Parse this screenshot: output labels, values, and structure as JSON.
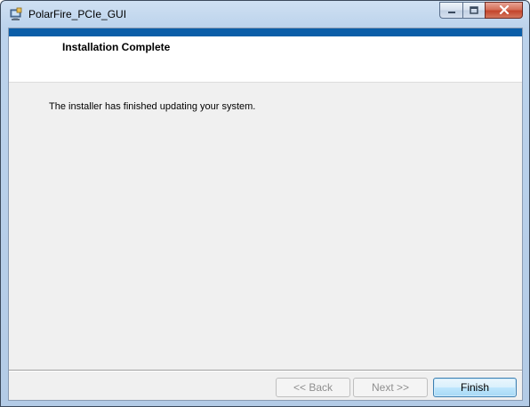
{
  "window": {
    "title": "PolarFire_PCIe_GUI"
  },
  "header": {
    "title": "Installation Complete"
  },
  "main": {
    "message": "The installer has finished updating your system."
  },
  "buttons": {
    "back_label": "<< Back",
    "next_label": "Next >>",
    "finish_label": "Finish"
  },
  "colors": {
    "accent_strip": "#0b5ea8",
    "client_background": "#f0f0f0",
    "close_button": "#c3452c"
  },
  "icons": {
    "app": "installer-app-icon",
    "minimize": "minimize-icon",
    "maximize": "maximize-icon",
    "close": "close-icon"
  }
}
